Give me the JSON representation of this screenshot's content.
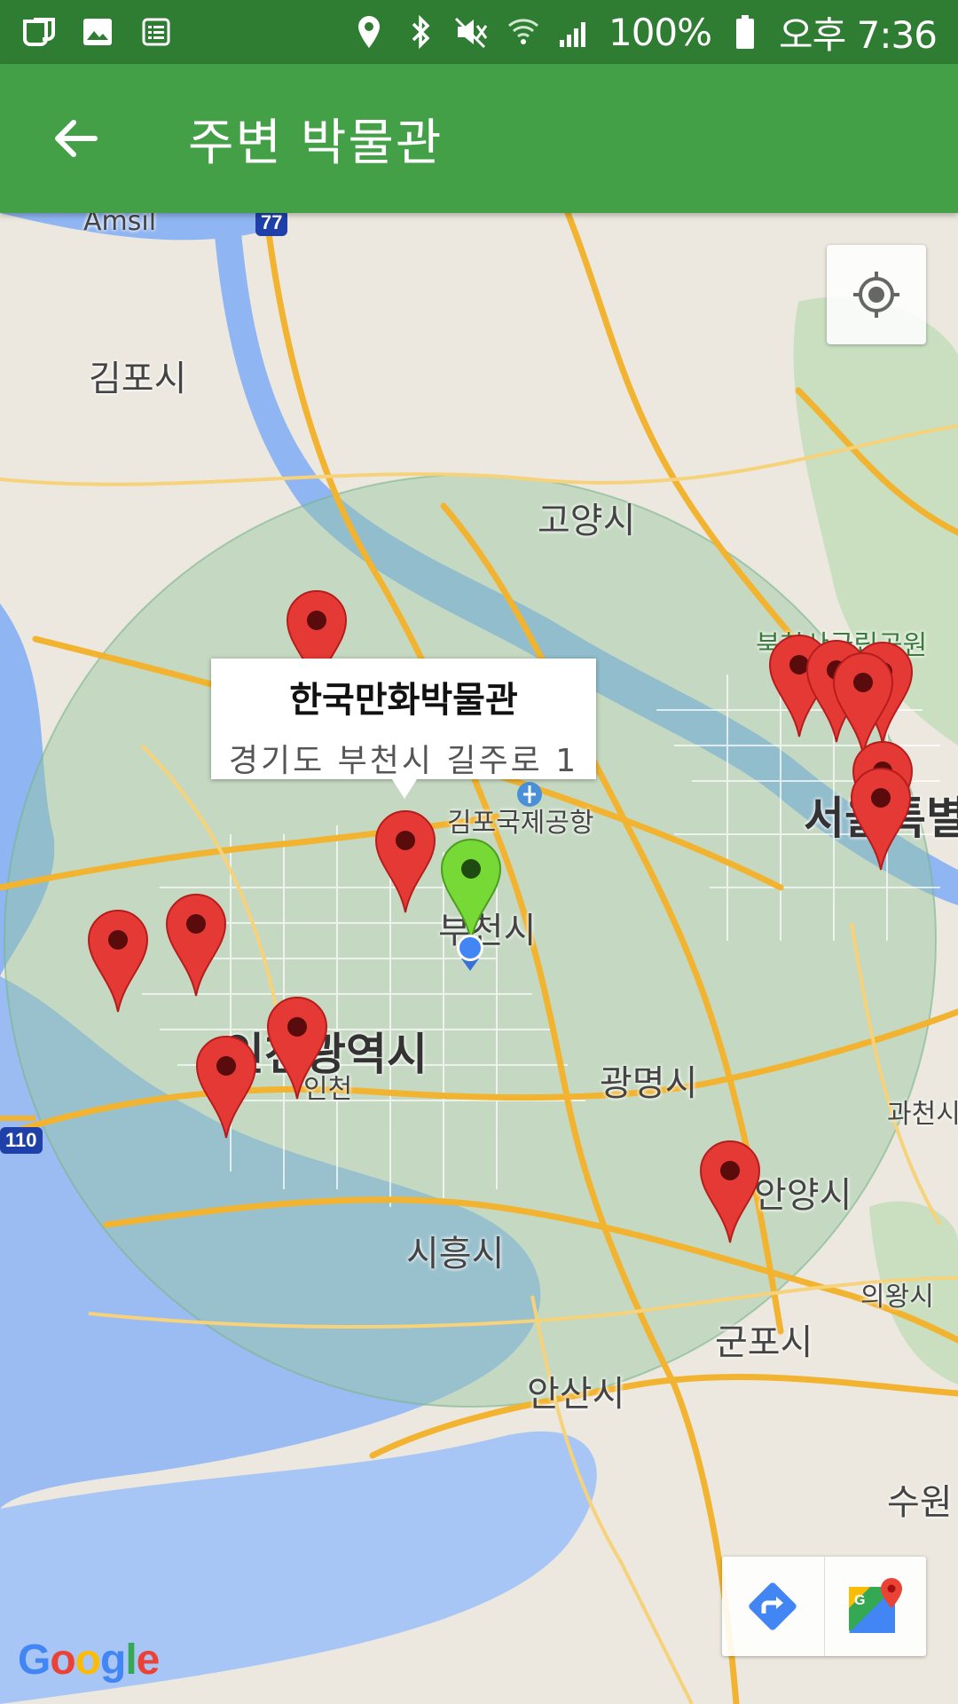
{
  "status_bar": {
    "battery": "100%",
    "time": "오후 7:36",
    "icons": [
      "app-icon",
      "gallery-icon",
      "notes-icon",
      "location-icon",
      "bluetooth-icon",
      "mute-icon",
      "wifi-icon",
      "signal-icon",
      "battery-icon"
    ]
  },
  "app_bar": {
    "title": "주변 박물관",
    "back_icon": "arrow-back-icon"
  },
  "map": {
    "labels": {
      "amsil": "Amsil",
      "gimpo": "김포시",
      "goyang": "고양시",
      "bukhansan": "북한산국립공원",
      "seoul": "서울특별",
      "gimpo_airport": "김포국제공항",
      "bucheon": "부천시",
      "incheon_city": "인천광역시",
      "incheon": "인천",
      "gwangmyeong": "광명시",
      "gwacheon": "과천시",
      "anyang": "안양시",
      "siheung": "시흥시",
      "uiwang": "의왕시",
      "gunpo": "군포시",
      "ansan": "안산시",
      "suwon": "수원",
      "route_110": "110",
      "route_77": "77"
    },
    "info_window": {
      "title": "한국만화박물관",
      "address": "경기도 부천시 길주로 1"
    },
    "marker_colors": {
      "museum": "#e53935",
      "selected_current": "#76d936",
      "user_dot": "#4285f4"
    },
    "google_logo": "Google"
  },
  "controls": {
    "my_location_icon": "crosshair-icon",
    "directions_icon": "directions-icon",
    "open_maps_icon": "google-maps-icon"
  }
}
